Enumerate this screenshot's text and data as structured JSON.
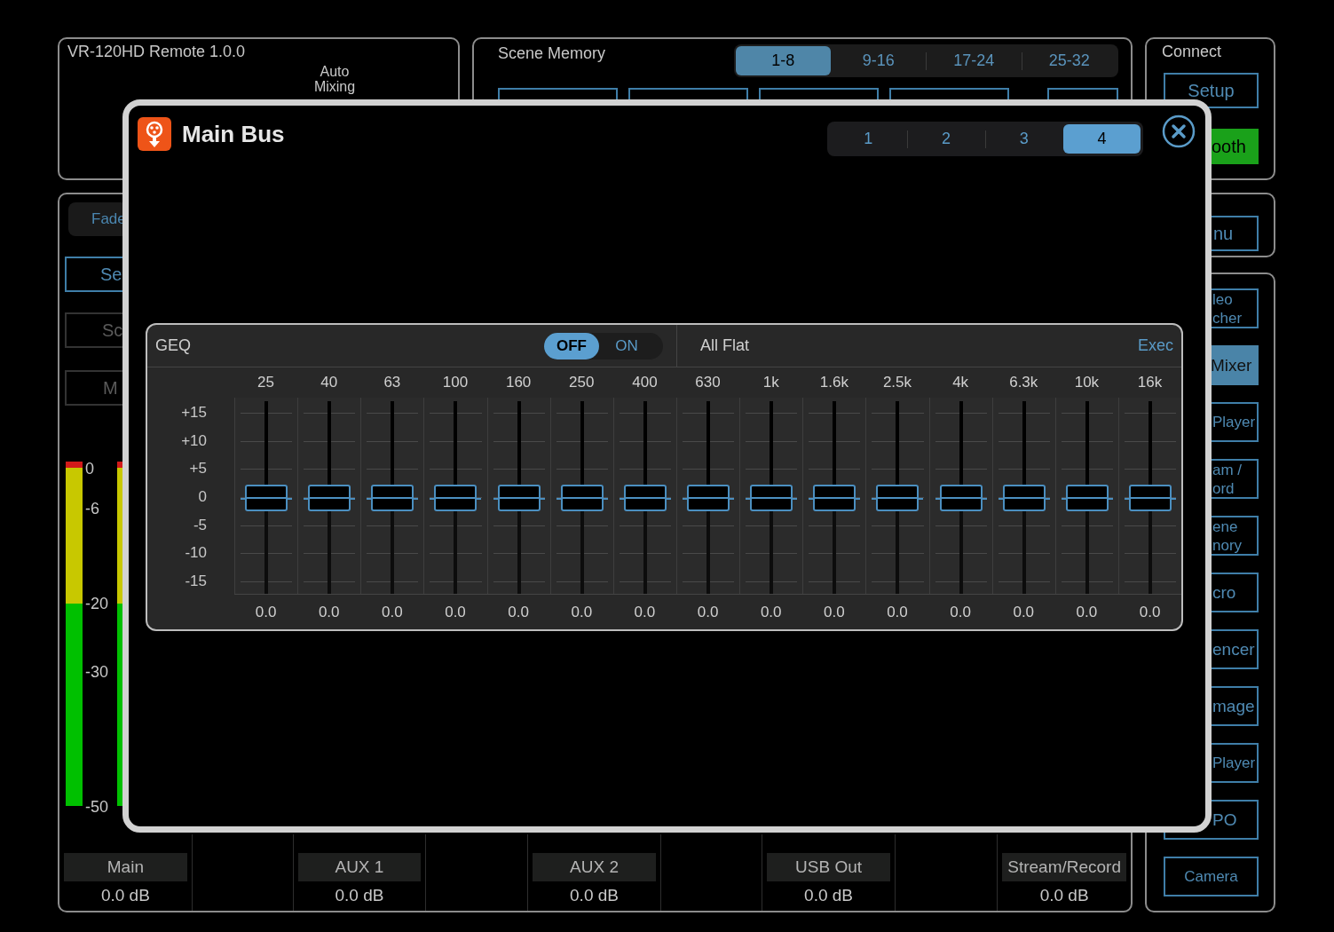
{
  "app": {
    "title": "VR-120HD Remote 1.0.0",
    "auto_mixing": "Auto Mixing"
  },
  "scene_memory": {
    "title": "Scene Memory",
    "banks": [
      {
        "label": "1-8",
        "selected": true
      },
      {
        "label": "9-16",
        "selected": false
      },
      {
        "label": "17-24",
        "selected": false
      },
      {
        "label": "25-32",
        "selected": false
      }
    ]
  },
  "connect": {
    "title": "Connect",
    "buttons": [
      {
        "label": "Setup",
        "kind": "outline"
      },
      {
        "label": "ooth",
        "kind": "active"
      }
    ]
  },
  "left_panel": {
    "tab": "Fade",
    "buttons": [
      {
        "label": "Se",
        "disabled": false
      },
      {
        "label": "Sc",
        "disabled": true
      },
      {
        "label": "M",
        "disabled": true
      }
    ],
    "meter_scale": [
      "0",
      "-6",
      "-20",
      "-30",
      "-50"
    ]
  },
  "outputs": [
    {
      "name": "Main",
      "value": "0.0 dB"
    },
    {
      "name": "AUX 1",
      "value": "0.0 dB"
    },
    {
      "name": "AUX 2",
      "value": "0.0 dB"
    },
    {
      "name": "USB Out",
      "value": "0.0 dB"
    },
    {
      "name": "Stream/Record",
      "value": "0.0 dB"
    }
  ],
  "menu_button": "nu",
  "side_buttons": [
    {
      "lines": [
        "leo",
        "cher"
      ],
      "selected": false
    },
    {
      "lines": [
        "Mixer"
      ],
      "selected": true
    },
    {
      "lines": [
        "Player"
      ],
      "selected": false
    },
    {
      "lines": [
        "am /",
        "ord"
      ],
      "selected": false
    },
    {
      "lines": [
        "ene",
        "nory"
      ],
      "selected": false
    },
    {
      "lines": [
        "cro"
      ],
      "selected": false
    },
    {
      "lines": [
        "encer"
      ],
      "selected": false
    },
    {
      "lines": [
        "mage"
      ],
      "selected": false
    },
    {
      "lines": [
        "Player"
      ],
      "selected": false
    },
    {
      "lines": [
        "PO"
      ],
      "selected": false
    },
    {
      "lines": [
        "Camera"
      ],
      "selected": false
    }
  ],
  "dialog": {
    "title": "Main Bus",
    "pages": [
      {
        "label": "1",
        "selected": false
      },
      {
        "label": "2",
        "selected": false
      },
      {
        "label": "3",
        "selected": false
      },
      {
        "label": "4",
        "selected": true
      }
    ],
    "geq": {
      "title": "GEQ",
      "switch": [
        {
          "label": "OFF",
          "selected": true
        },
        {
          "label": "ON",
          "selected": false
        }
      ],
      "preset": "All Flat",
      "exec": "Exec",
      "scale": [
        "+15",
        "+10",
        "+5",
        "0",
        "-5",
        "-10",
        "-15"
      ],
      "bands": [
        {
          "freq": "25",
          "value": "0.0",
          "level": 0.5
        },
        {
          "freq": "40",
          "value": "0.0",
          "level": 0.5
        },
        {
          "freq": "63",
          "value": "0.0",
          "level": 0.5
        },
        {
          "freq": "100",
          "value": "0.0",
          "level": 0.5
        },
        {
          "freq": "160",
          "value": "0.0",
          "level": 0.5
        },
        {
          "freq": "250",
          "value": "0.0",
          "level": 0.5
        },
        {
          "freq": "400",
          "value": "0.0",
          "level": 0.5
        },
        {
          "freq": "630",
          "value": "0.0",
          "level": 0.5
        },
        {
          "freq": "1k",
          "value": "0.0",
          "level": 0.5
        },
        {
          "freq": "1.6k",
          "value": "0.0",
          "level": 0.5
        },
        {
          "freq": "2.5k",
          "value": "0.0",
          "level": 0.5
        },
        {
          "freq": "4k",
          "value": "0.0",
          "level": 0.5
        },
        {
          "freq": "6.3k",
          "value": "0.0",
          "level": 0.5
        },
        {
          "freq": "10k",
          "value": "0.0",
          "level": 0.5
        },
        {
          "freq": "16k",
          "value": "0.0",
          "level": 0.5
        }
      ]
    }
  }
}
